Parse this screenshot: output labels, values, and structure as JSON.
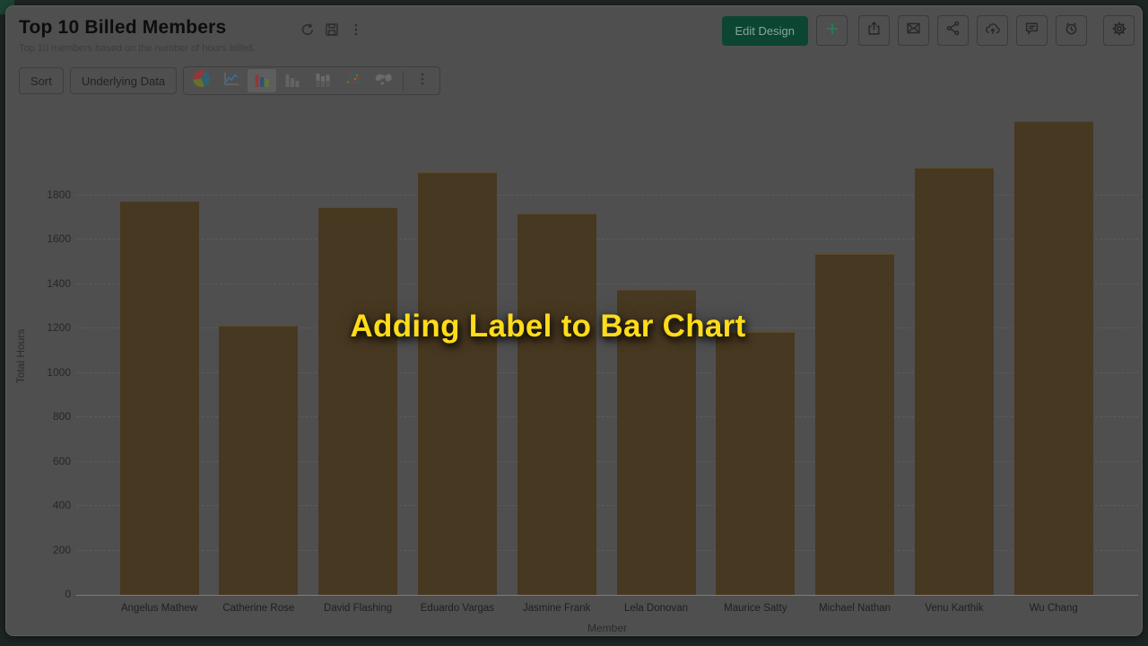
{
  "header": {
    "title": "Top 10 Billed Members",
    "subtitle": "Top 10 members based on the number of hours billed.",
    "title_icons": [
      "refresh-icon",
      "save-icon",
      "more-vertical-icon"
    ],
    "edit_design_label": "Edit Design",
    "action_icons": [
      "plus-icon",
      "export-icon",
      "mail-icon",
      "share-icon",
      "cloud-upload-icon",
      "comment-icon",
      "reminder-icon",
      "settings-icon"
    ],
    "accent_green": "#0D4533"
  },
  "toolbar": {
    "sort_label": "Sort",
    "underlying_data_label": "Underlying Data",
    "chart_types": [
      "pie",
      "line",
      "bar",
      "column",
      "stacked-column",
      "scatter",
      "map"
    ],
    "selected_chart_type": "bar",
    "more_icon": "more-vertical-icon"
  },
  "overlay": {
    "caption": "Adding Label to Bar Chart",
    "caption_color": "#FFDC19"
  },
  "chart_data": {
    "type": "bar",
    "title": "Top 10 Billed Members",
    "categories": [
      "Angelus Mathew",
      "Catherine Rose",
      "David Flashing",
      "Eduardo Vargas",
      "Jasmine Frank",
      "Lela Donovan",
      "Maurice Satty",
      "Michael Nathan",
      "Venu Karthik",
      "Wu Chang"
    ],
    "values": [
      1770,
      1210,
      1745,
      1900,
      1715,
      1370,
      1180,
      1535,
      1920,
      2130
    ],
    "xlabel": "Member",
    "ylabel": "Total Hours",
    "yticks": [
      0,
      200,
      400,
      600,
      800,
      1000,
      1200,
      1400,
      1600,
      1800
    ],
    "ylim": [
      0,
      2200
    ],
    "grid": true,
    "legend": false,
    "bar_color": "#473821"
  }
}
